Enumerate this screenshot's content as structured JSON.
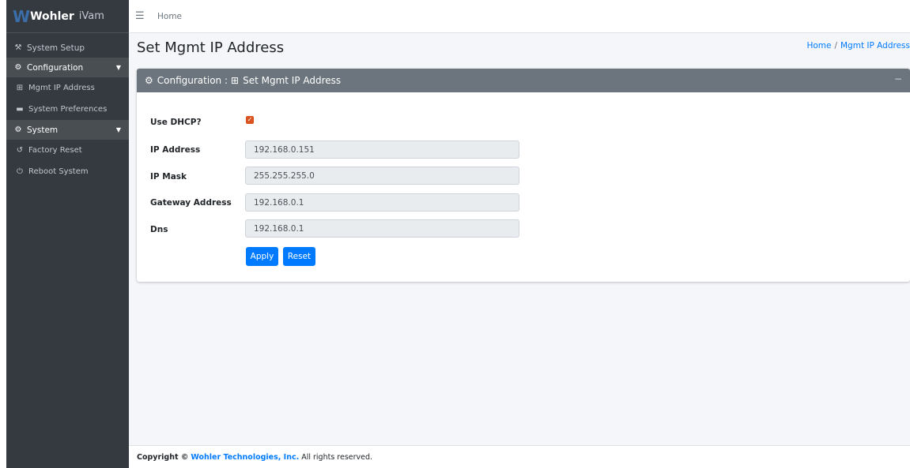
{
  "brand": {
    "logo_text": "Wohler",
    "app_name": "iVam"
  },
  "sidebar": {
    "items": [
      {
        "label": "System Setup",
        "icon": "tools-icon",
        "glyph": "⚒"
      },
      {
        "label": "Configuration",
        "icon": "gear-icon",
        "glyph": "⚙"
      },
      {
        "label": "Mgmt IP Address",
        "icon": "network-icon",
        "glyph": "⊞"
      },
      {
        "label": "System Preferences",
        "icon": "keyboard-icon",
        "glyph": "▬"
      },
      {
        "label": "System",
        "icon": "gears-icon",
        "glyph": "⚙"
      },
      {
        "label": "Factory Reset",
        "icon": "undo-icon",
        "glyph": "↺"
      },
      {
        "label": "Reboot System",
        "icon": "power-icon",
        "glyph": "⏻"
      }
    ]
  },
  "topbar": {
    "home_link": "Home"
  },
  "page": {
    "title": "Set Mgmt IP Address",
    "breadcrumb": {
      "home": "Home",
      "separator": "/",
      "current": "Mgmt IP Address"
    }
  },
  "card": {
    "header_prefix": "Configuration :",
    "header_title": "Set Mgmt IP Address",
    "collapse_symbol": "−"
  },
  "form": {
    "dhcp_label": "Use DHCP?",
    "dhcp_checked": true,
    "ip_label": "IP Address",
    "ip_value": "192.168.0.151",
    "mask_label": "IP Mask",
    "mask_value": "255.255.255.0",
    "gateway_label": "Gateway Address",
    "gateway_value": "192.168.0.1",
    "dns_label": "Dns",
    "dns_value": "192.168.0.1",
    "apply_label": "Apply",
    "reset_label": "Reset"
  },
  "footer": {
    "prefix": "Copyright ©",
    "company": "Wohler Technologies, Inc.",
    "suffix": "All rights reserved."
  },
  "colors": {
    "sidebar_bg": "#343a40",
    "card_header_bg": "#6c757d",
    "primary": "#007bff",
    "checkbox": "#d9531e"
  }
}
